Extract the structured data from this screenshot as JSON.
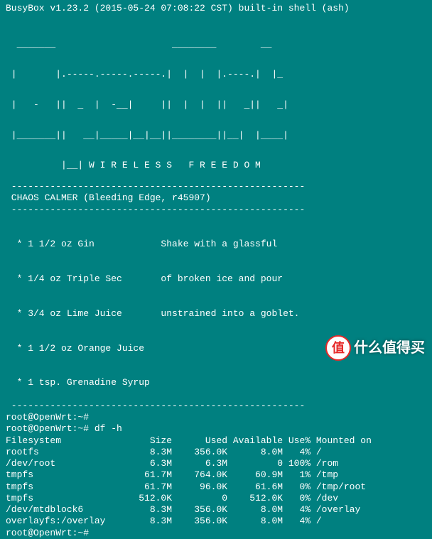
{
  "banner": "BusyBox v1.23.2 (2015-05-24 07:08:22 CST) built-in shell (ash)",
  "art": {
    "l1": "  _______                     ________        __",
    "l2": " |       |.-----.-----.-----.|  |  |  |.----.|  |_",
    "l3": " |   -   ||  _  |  -__|     ||  |  |  ||   _||   _|",
    "l4": " |_______||   __|_____|__|__||________||__|  |____|",
    "l5": "          |__| W I R E L E S S   F R E E D O M"
  },
  "hr": " -----------------------------------------------------",
  "release": " CHAOS CALMER (Bleeding Edge, r45907)",
  "recipe": {
    "r1": "  * 1 1/2 oz Gin            Shake with a glassful",
    "r2": "  * 1/4 oz Triple Sec       of broken ice and pour",
    "r3": "  * 3/4 oz Lime Juice       unstrained into a goblet.",
    "r4": "  * 1 1/2 oz Orange Juice",
    "r5": "  * 1 tsp. Grenadine Syrup"
  },
  "prompts": {
    "p1": "root@OpenWrt:~#",
    "p2": "root@OpenWrt:~# df -h",
    "p3": "root@OpenWrt:~#"
  },
  "df": {
    "header": "Filesystem                Size      Used Available Use% Mounted on",
    "rows": {
      "r0": "rootfs                    8.3M    356.0K      8.0M   4% /",
      "r1": "/dev/root                 6.3M      6.3M         0 100% /rom",
      "r2": "tmpfs                    61.7M    764.0K     60.9M   1% /tmp",
      "r3": "tmpfs                    61.7M     96.0K     61.6M   0% /tmp/root",
      "r4": "tmpfs                   512.0K         0    512.0K   0% /dev",
      "r5": "/dev/mtdblock6            8.3M    356.0K      8.0M   4% /overlay",
      "r6": "overlayfs:/overlay        8.3M    356.0K      8.0M   4% /"
    }
  },
  "watermark": {
    "badge": "值",
    "text": "什么值得买"
  }
}
